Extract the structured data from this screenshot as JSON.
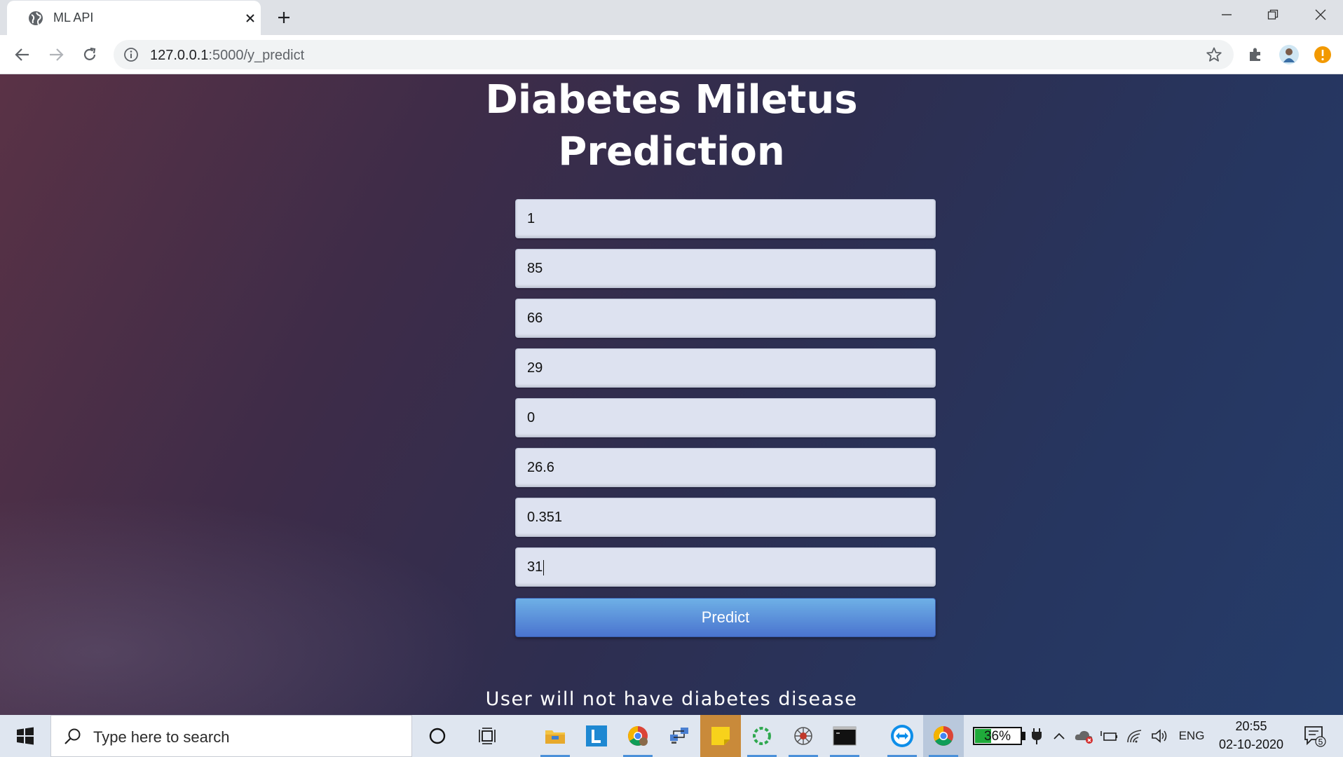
{
  "browser": {
    "tab_title": "ML API",
    "url_host": "127.0.0.1",
    "url_path": ":5000/y_predict"
  },
  "page": {
    "title_line1": "Diabetes Miletus",
    "title_line2": "Prediction",
    "fields": [
      "1",
      "85",
      "66",
      "29",
      "0",
      "26.6",
      "0.351",
      "31"
    ],
    "predict_label": "Predict",
    "result": "User will not have diabetes disease"
  },
  "taskbar": {
    "search_placeholder": "Type here to search",
    "battery": "36%",
    "battery_percent": 36,
    "language": "ENG",
    "time": "20:55",
    "date": "02-10-2020",
    "notification_count": "5"
  },
  "colors": {
    "button": "#4a74cf",
    "field_bg": "#dde2f0",
    "battery_fill": "#1faa3a"
  }
}
